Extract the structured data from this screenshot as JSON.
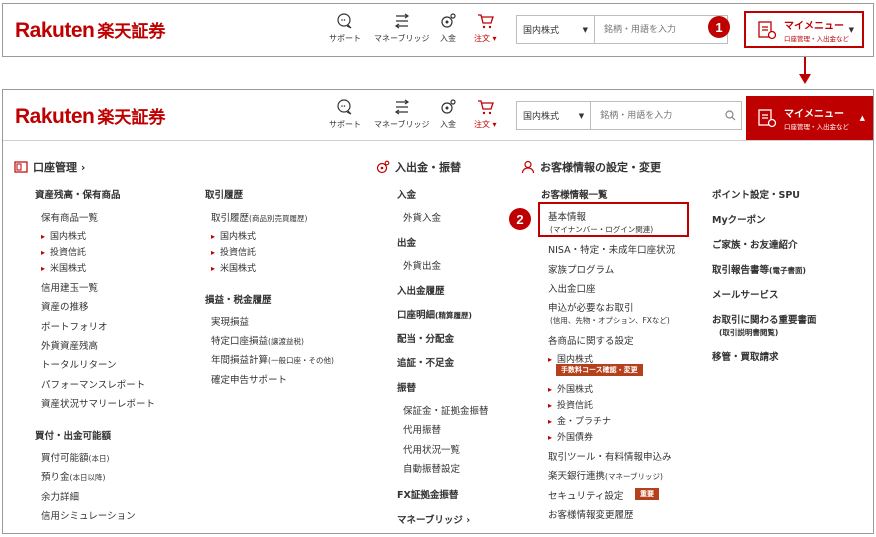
{
  "brand": {
    "logo_en": "Rakuten",
    "logo_jp": "楽天証券",
    "color": "#bf0000"
  },
  "nav": {
    "support": "サポート",
    "moneybridge": "マネーブリッジ",
    "deposit": "入金",
    "order": "注文 ▾"
  },
  "search": {
    "market": "国内株式",
    "placeholder": "銘柄・用語を入力"
  },
  "mymenu": {
    "title": "マイメニュー",
    "subtitle": "口座管理・入出金など"
  },
  "badges": {
    "one": "1",
    "two": "2"
  },
  "sections": {
    "account": "口座管理 ›",
    "funds": "入出金・振替",
    "customer": "お客様情報の設定・変更"
  },
  "col1": {
    "h1": "資産残高・保有商品",
    "holdings": "保有商品一覧",
    "domestic": "国内株式",
    "trust": "投資信託",
    "us": "米国株式",
    "margin": "信用建玉一覧",
    "trend": "資産の推移",
    "portfolio": "ポートフォリオ",
    "foreign": "外貨資産残高",
    "total_return": "トータルリターン",
    "performance": "パフォーマンスレポート",
    "summary": "資産状況サマリーレポート",
    "h2": "買付・出金可能額",
    "buyable": "買付可能額",
    "buyable_note": "(本日)",
    "deposit": "預り金",
    "deposit_note": "(本日以降)",
    "surplus": "余力詳細",
    "simulation": "信用シミュレーション"
  },
  "col2": {
    "h1": "取引履歴",
    "history": "取引履歴",
    "history_note": "(商品別売買履歴)",
    "domestic": "国内株式",
    "trust": "投資信託",
    "us": "米国株式",
    "h2": "損益・税金履歴",
    "realized": "実現損益",
    "specific": "特定口座損益",
    "specific_note": "(譲渡益税)",
    "annual": "年間損益計算",
    "annual_note": "(一般口座・その他)",
    "tax_return": "確定申告サポート"
  },
  "col3": {
    "deposit_h": "入金",
    "foreign_deposit": "外貨入金",
    "withdraw_h": "出金",
    "foreign_withdraw": "外貨出金",
    "history": "入出金履歴",
    "statement": "口座明細",
    "statement_note": "(精算履歴)",
    "dividend": "配当・分配金",
    "margin_call": "追証・不足金",
    "transfer": "振替",
    "collateral": "保証金・証拠金振替",
    "substitute": "代用振替",
    "substitute_status": "代用状況一覧",
    "auto_transfer": "自動振替設定",
    "fx_transfer": "FX証拠金振替",
    "moneybridge": "マネーブリッジ ›"
  },
  "col4": {
    "h": "お客様情報一覧",
    "basic": "基本情報",
    "basic_note": "(マイナンバー・ログイン関連)",
    "nisa": "NISA・特定・未成年口座状況",
    "family": "家族プログラム",
    "bank": "入出金口座",
    "application": "申込が必要なお取引",
    "application_note": "(信用、先物・オプション、FXなど)",
    "product_settings": "各商品に関する設定",
    "domestic": "国内株式",
    "fee_tag": "手数料コース確認・変更",
    "foreign_stock": "外国株式",
    "trust": "投資信託",
    "gold": "金・プラチナ",
    "foreign_bond": "外国債券",
    "tools": "取引ツール・有料情報申込み",
    "bank_link": "楽天銀行連携",
    "bank_link_note": "(マネーブリッジ)",
    "security": "セキュリティ設定",
    "security_tag": "重要",
    "change_history": "お客様情報変更履歴"
  },
  "col5": {
    "points": "ポイント設定・SPU",
    "coupon": "Myクーポン",
    "referral": "ご家族・お友達紹介",
    "report": "取引報告書等",
    "report_note": "(電子書面)",
    "mail": "メールサービス",
    "docs": "お取引に関わる重要書面",
    "docs_note": "(取引説明書閲覧)",
    "transfer_out": "移管・買取請求"
  }
}
